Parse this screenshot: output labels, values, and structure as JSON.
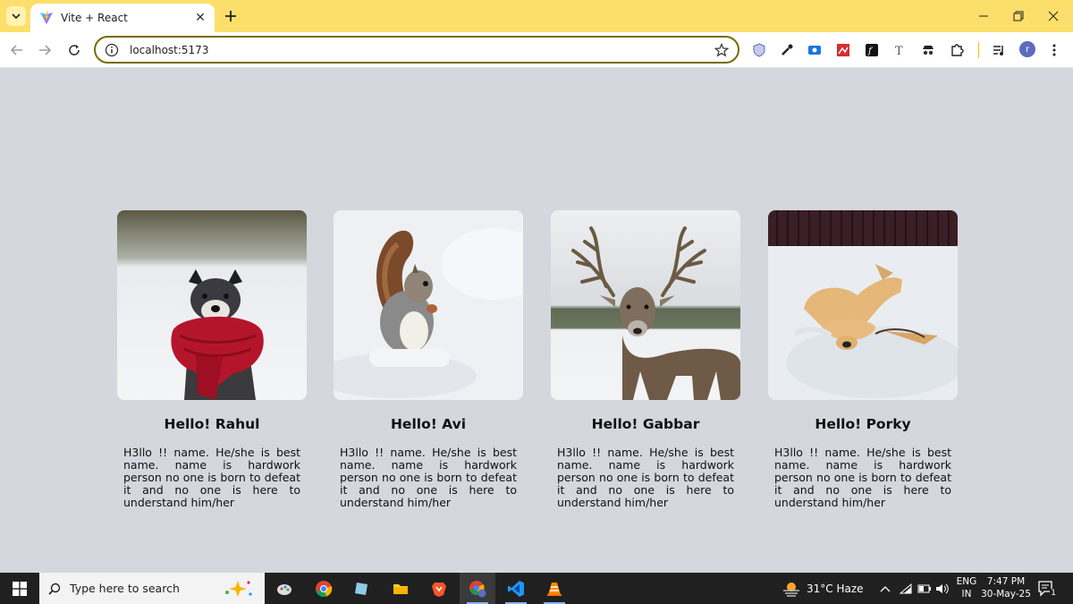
{
  "browser": {
    "tab": {
      "title": "Vite + React"
    },
    "address_bar": {
      "url": "localhost:5173"
    },
    "profile_initial": "r",
    "extensions": [
      "shield-icon",
      "eyedropper-icon",
      "screen-record-icon",
      "image-ext-icon",
      "font-ext-icon",
      "text-ext-icon",
      "spy-ext-icon",
      "puzzle-icon"
    ]
  },
  "cards": [
    {
      "title": "Hello! Rahul",
      "text": "H3llo !! name. He/she is best name. name is hardwork person no one is born to defeat it and no one is here to understand him/her",
      "image": "dog-in-red-scarf"
    },
    {
      "title": "Hello! Avi",
      "text": "H3llo !! name. He/she is best name. name is hardwork person no one is born to defeat it and no one is here to understand him/her",
      "image": "squirrel-in-snow"
    },
    {
      "title": "Hello! Gabbar",
      "text": "H3llo !! name. He/she is best name. name is hardwork person no one is born to defeat it and no one is here to understand him/her",
      "image": "deer-in-snow"
    },
    {
      "title": "Hello! Porky",
      "text": "H3llo !! name. He/she is best name. name is hardwork person no one is born to defeat it and no one is here to understand him/her",
      "image": "dog-rolling-in-snow"
    }
  ],
  "taskbar": {
    "search_placeholder": "Type here to search",
    "weather": "31°C  Haze",
    "language_line1": "ENG",
    "language_line2": "IN",
    "time": "7:47 PM",
    "date": "30-May-25",
    "notification_count": "1"
  },
  "colors": {
    "tab_strip": "#fcdf6b",
    "page_background": "#d4d7dd",
    "taskbar": "#202020",
    "omnibox_border": "#7a6a00"
  }
}
